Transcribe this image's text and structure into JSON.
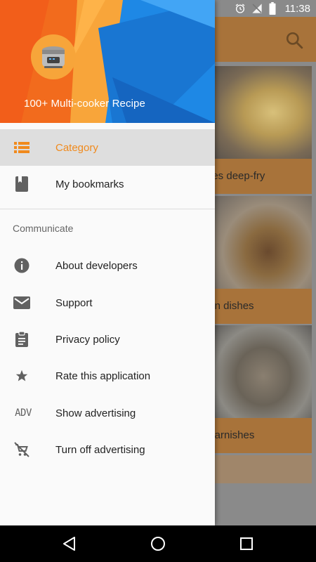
{
  "status_bar": {
    "time": "11:38",
    "icons": [
      "alarm-icon",
      "no-signal-icon",
      "battery-icon"
    ]
  },
  "background": {
    "toolbar_color": "#a8733a",
    "cards": [
      {
        "label": "hes deep-fry"
      },
      {
        "label": "ain dishes"
      },
      {
        "label": "Garnishes"
      }
    ]
  },
  "drawer": {
    "header": {
      "app_name": "100+ Multi-cooker Recipe",
      "colors": {
        "orange": "#f26b1d",
        "blue": "#1e88e5",
        "accent": "#f7a53a"
      }
    },
    "primary_items": [
      {
        "label": "Category",
        "icon": "list-icon",
        "active": true
      },
      {
        "label": "My bookmarks",
        "icon": "bookmark-icon",
        "active": false
      }
    ],
    "section_title": "Communicate",
    "secondary_items": [
      {
        "label": "About developers",
        "icon": "info-icon"
      },
      {
        "label": "Support",
        "icon": "mail-icon"
      },
      {
        "label": "Privacy policy",
        "icon": "clipboard-icon"
      },
      {
        "label": "Rate this application",
        "icon": "star-icon"
      },
      {
        "label": "Show advertising",
        "icon": "adv-icon",
        "icon_text": "ADV"
      },
      {
        "label": "Turn off advertising",
        "icon": "remove-cart-icon"
      }
    ],
    "active_color": "#f08a1d"
  },
  "nav_bar": {
    "buttons": [
      "back-icon",
      "home-icon",
      "recents-icon"
    ]
  }
}
